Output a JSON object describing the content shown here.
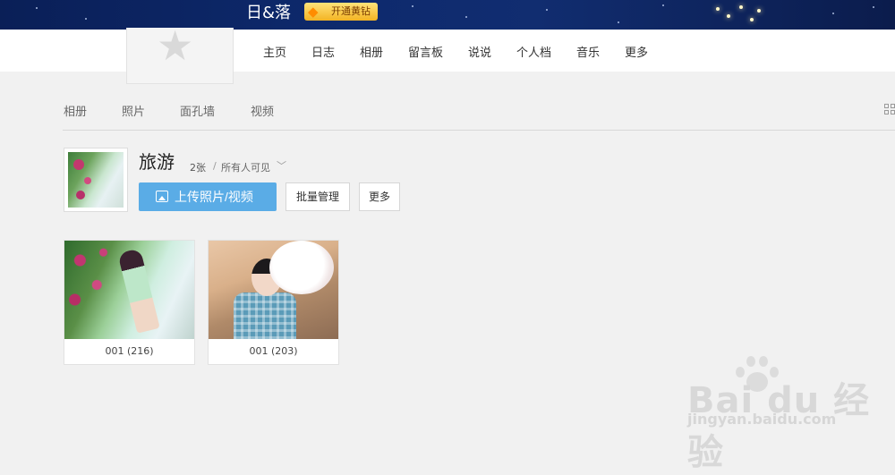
{
  "header": {
    "site_name": "日&落",
    "vip_label": "开通黄钻"
  },
  "nav": {
    "items": [
      "主页",
      "日志",
      "相册",
      "留言板",
      "说说",
      "个人档",
      "音乐",
      "更多"
    ]
  },
  "tabs": [
    "相册",
    "照片",
    "面孔墙",
    "视频"
  ],
  "album": {
    "title": "旅游",
    "count": "2张",
    "separator": "/",
    "visibility": "所有人可见",
    "upload_label": "上传照片/视频",
    "batch_label": "批量管理",
    "more_label": "更多"
  },
  "photos": [
    {
      "caption": "001 (216)"
    },
    {
      "caption": "001 (203)"
    }
  ],
  "watermark": {
    "text": "Bai du 经验",
    "sub": "jingyan.baidu.com"
  },
  "colors": {
    "banner": "#0e2a6e",
    "upload_button": "#5aace6",
    "vip_gold": "#f3b323"
  }
}
